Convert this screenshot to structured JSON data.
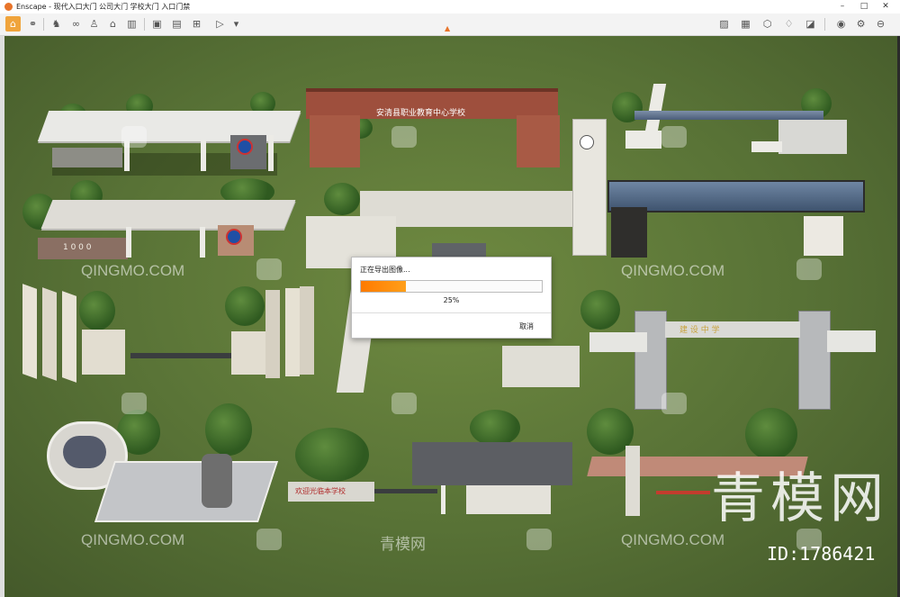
{
  "window": {
    "title": "Enscape - 现代入口大门 公司大门 学校大门 入口门禁",
    "buttons": [
      "–",
      "□",
      "✕"
    ]
  },
  "toolbar": {
    "left_icons": [
      "home-icon",
      "link-icon",
      "binoculars-icon",
      "person-icon",
      "house-icon",
      "building-icon",
      "vr-icon",
      "screenshot-icon",
      "batch-render-icon",
      "panorama-icon",
      "video-icon"
    ],
    "right_icons": [
      "asset-library-icon",
      "material-icon",
      "view-management-icon",
      "object-icon",
      "atmosphere-icon",
      "settings-panel-icon",
      "visual-settings-icon",
      "gear-icon"
    ]
  },
  "scene": {
    "signs": {
      "school_arch": "安清县职业教育中心学校",
      "stone_wall": "1 0 0 0",
      "towers_banner": "建 设 中 学",
      "small_wall": "欢迎光临本学校"
    }
  },
  "watermarks": {
    "brand": "QINGMO.COM",
    "brand_cn": "青模网",
    "big": "青模网",
    "id": "ID:1786421"
  },
  "dialog": {
    "title": "正在导出图像...",
    "progress": 0.25,
    "progress_text": "25%",
    "cancel_label": "取消",
    "progress_color": "#ff7a00"
  }
}
